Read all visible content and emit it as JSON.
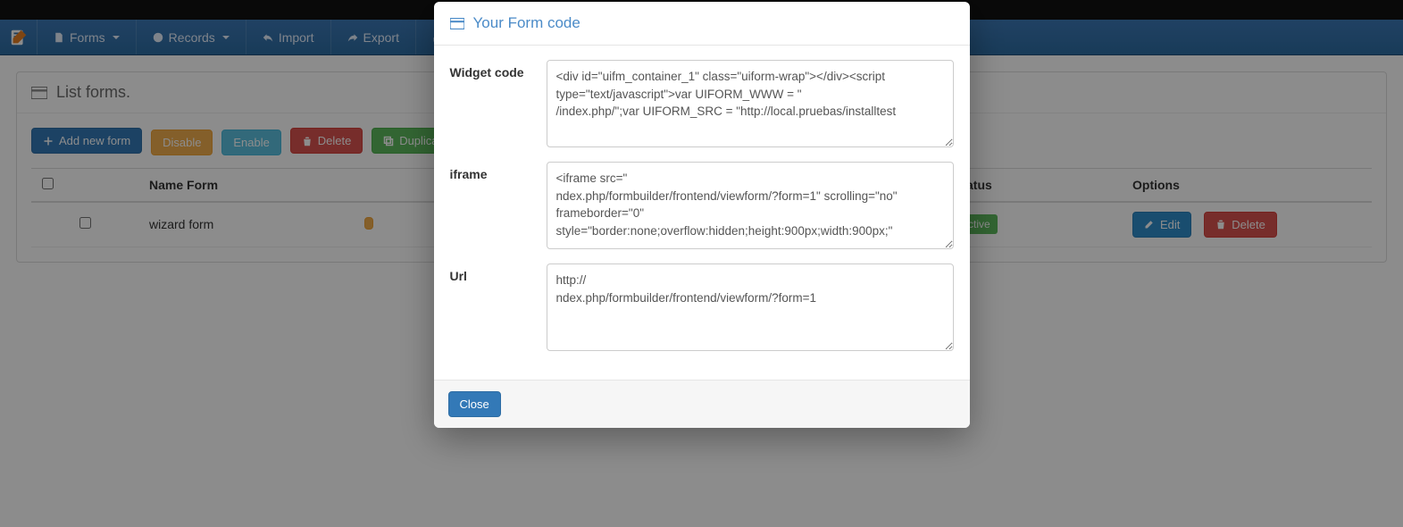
{
  "nav": {
    "forms": "Forms",
    "records": "Records",
    "import": "Import",
    "export": "Export"
  },
  "panel": {
    "title": "List forms."
  },
  "toolbar": {
    "add": "Add new form",
    "disable": "Disable",
    "enable": "Enable",
    "delete": "Delete",
    "duplicate": "Duplicate"
  },
  "table": {
    "headers": {
      "name": "Name Form",
      "status": "Status",
      "options": "Options"
    },
    "rows": [
      {
        "name": "wizard form",
        "status": "Active",
        "edit": "Edit",
        "delete": "Delete"
      }
    ]
  },
  "modal": {
    "title": "Your Form code",
    "widget_label": "Widget code",
    "iframe_label": "iframe",
    "url_label": "Url",
    "widget_value": "<div id=\"uifm_container_1\" class=\"uiform-wrap\"></div><script type=\"text/javascript\">var UIFORM_WWW = \"                                                              /index.php/\";var UIFORM_SRC = \"http://local.pruebas/installtest",
    "iframe_value": "<iframe src=\"                                                 ndex.php/formbuilder/frontend/viewform/?form=1\" scrolling=\"no\" frameborder=\"0\" style=\"border:none;overflow:hidden;height:900px;width:900px;\"",
    "url_value": "http://                                                         ndex.php/formbuilder/frontend/viewform/?form=1",
    "close": "Close"
  }
}
